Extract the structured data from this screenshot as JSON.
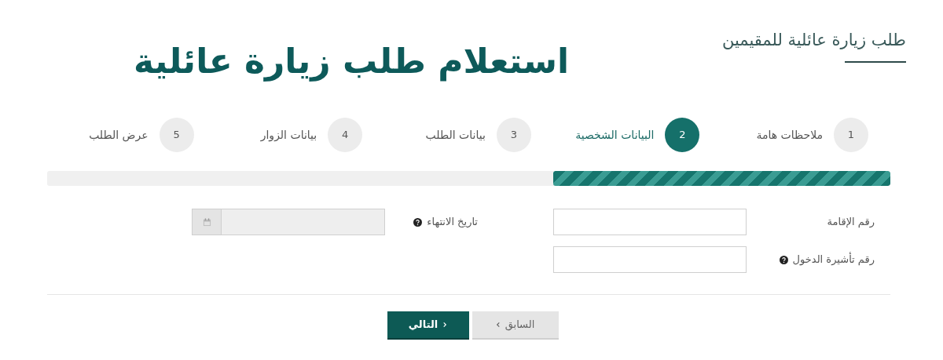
{
  "header": {
    "title": "طلب زيارة عائلية للمقيمين",
    "overlay_heading": "استعلام طلب زيارة عائلية"
  },
  "steps": [
    {
      "number": "1",
      "label": "ملاحظات هامة",
      "selected": false
    },
    {
      "number": "2",
      "label": "البيانات الشخصية",
      "selected": true
    },
    {
      "number": "3",
      "label": "بيانات الطلب",
      "selected": false
    },
    {
      "number": "4",
      "label": "بيانات الزوار",
      "selected": false
    },
    {
      "number": "5",
      "label": "عرض الطلب",
      "selected": false
    }
  ],
  "progress": {
    "level": 0.4
  },
  "form": {
    "rows": [
      [
        {
          "label": "رقم الإقامة",
          "help": false,
          "kind": "text"
        },
        {
          "label": "تاريخ الانتهاء",
          "help": true,
          "kind": "date"
        }
      ],
      [
        {
          "label": "رقم تأشيرة الدخول",
          "help": true,
          "kind": "text"
        }
      ]
    ]
  },
  "buttons": [
    {
      "label": "السابق",
      "kind": "previous"
    },
    {
      "label": "التالي",
      "kind": "next"
    }
  ]
}
